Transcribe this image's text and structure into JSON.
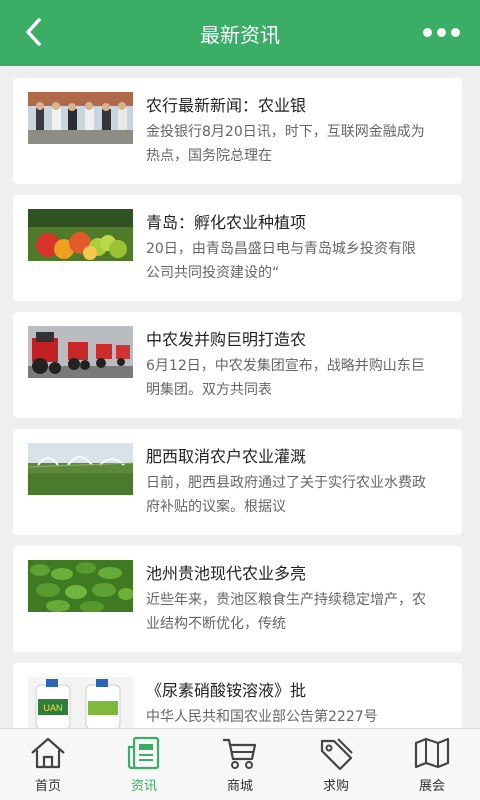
{
  "header": {
    "title": "最新资讯",
    "back_icon": "back-arrow-icon",
    "more_icon": "more-dots-icon"
  },
  "articles": [
    {
      "title": "农行最新新闻：农业银",
      "desc": "金投银行8月20日讯，时下，互联网金融成为热点，国务院总理在",
      "thumb": "meeting-photo"
    },
    {
      "title": "青岛：孵化农业种植项",
      "desc": "20日，由青岛昌盛日电与青岛城乡投资有限公司共同投资建设的“",
      "thumb": "fruit-photo"
    },
    {
      "title": "中农发并购巨明打造农",
      "desc": "6月12日，中农发集团宣布，战略并购山东巨明集团。双方共同表",
      "thumb": "tractor-photo"
    },
    {
      "title": "肥西取消农户农业灌溉",
      "desc": "日前，肥西县政府通过了关于实行农业水费政府补贴的议案。根据议",
      "thumb": "irrigation-photo"
    },
    {
      "title": "池州贵池现代农业多亮",
      "desc": "近些年来，贵池区粮食生产持续稳定增产，农业结构不断优化，传统",
      "thumb": "crop-field-photo"
    },
    {
      "title": "《尿素硝酸铵溶液》批",
      "desc": "中华人民共和国农业部公告第2227号",
      "thumb": "fertilizer-bottles-photo",
      "thumb_text": "UAN"
    }
  ],
  "tabs": [
    {
      "label": "首页",
      "icon": "home-icon",
      "active": false
    },
    {
      "label": "资讯",
      "icon": "news-icon",
      "active": true
    },
    {
      "label": "商城",
      "icon": "cart-icon",
      "active": false
    },
    {
      "label": "求购",
      "icon": "tag-icon",
      "active": false
    },
    {
      "label": "展会",
      "icon": "map-icon",
      "active": false
    }
  ],
  "colors": {
    "brand": "#3aad67",
    "background": "#efefef"
  }
}
